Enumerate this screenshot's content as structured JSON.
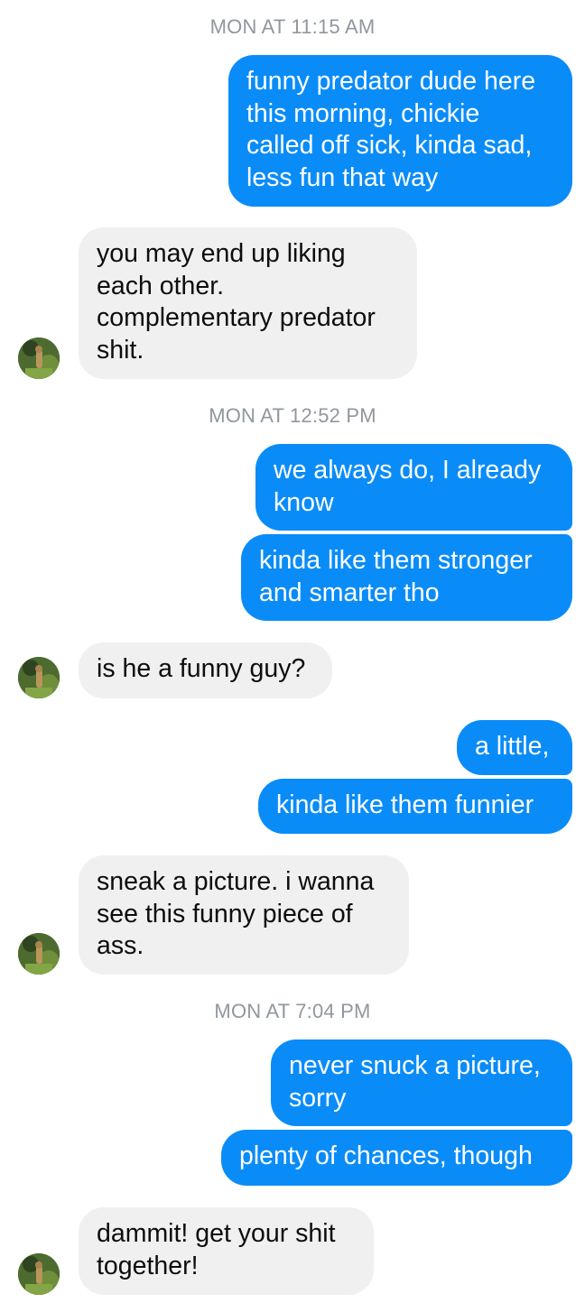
{
  "conversation": {
    "timestamps": [
      "MON AT 11:15 AM",
      "MON AT 12:52 PM",
      "MON AT 7:04 PM"
    ],
    "messages": [
      {
        "from": "me",
        "text": "funny predator dude here\nthis morning, chickie\ncalled off sick, kinda sad,\nless fun that way"
      },
      {
        "from": "them",
        "text": "you may end up liking\neach other.\ncomplementary predator\nshit."
      },
      {
        "from": "me",
        "text": "we always do, I already\nknow"
      },
      {
        "from": "me",
        "text": "kinda like them stronger\nand smarter tho"
      },
      {
        "from": "them",
        "text": "is he a funny guy?"
      },
      {
        "from": "me",
        "text": "a little,"
      },
      {
        "from": "me",
        "text": "kinda like them funnier"
      },
      {
        "from": "them",
        "text": "sneak a picture. i wanna\nsee this funny piece of\nass."
      },
      {
        "from": "me",
        "text": "never snuck a picture,\nsorry"
      },
      {
        "from": "me",
        "text": "plenty of chances, though"
      },
      {
        "from": "them",
        "text": "dammit! get your shit\ntogether!"
      }
    ]
  },
  "colors": {
    "outgoing_bubble": "#0a8cf8",
    "incoming_bubble": "#f1f0f0",
    "timestamp": "#9197a0"
  },
  "icons": {
    "avatar": "contact-avatar-photo"
  }
}
